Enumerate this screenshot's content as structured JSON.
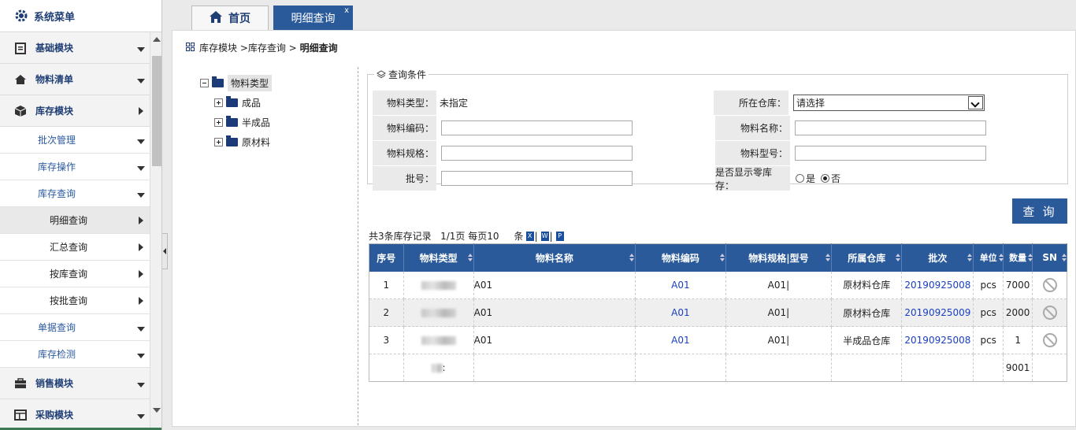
{
  "sidebar": {
    "title": "系统菜单",
    "items": [
      {
        "label": "基础模块"
      },
      {
        "label": "物料清单"
      },
      {
        "label": "库存模块"
      }
    ],
    "subitems": [
      {
        "label": "批次管理"
      },
      {
        "label": "库存操作"
      },
      {
        "label": "库存查询"
      }
    ],
    "subsubitems": [
      {
        "label": "明细查询"
      },
      {
        "label": "汇总查询"
      },
      {
        "label": "按库查询"
      },
      {
        "label": "按批查询"
      }
    ],
    "subitems2": [
      {
        "label": "单据查询"
      },
      {
        "label": "库存检测"
      }
    ],
    "items2": [
      {
        "label": "销售模块"
      },
      {
        "label": "采购模块"
      }
    ]
  },
  "tabs": {
    "home": "首页",
    "active": "明细查询",
    "close": "x"
  },
  "breadcrumb": {
    "path": "库存模块 >库存查询 > ",
    "current": "明细查询"
  },
  "tree": {
    "root": "物料类型",
    "children": [
      "成品",
      "半成品",
      "原材料"
    ]
  },
  "query": {
    "legend": "查询条件",
    "material_type_label": "物料类型：",
    "material_type_value": "未指定",
    "warehouse_label": "所在仓库：",
    "warehouse_value": "请选择",
    "code_label": "物料编码：",
    "name_label": "物料名称：",
    "spec_label": "物料规格：",
    "model_label": "物料型号：",
    "batch_label": "批号：",
    "zero_label": "是否显示零库存：",
    "zero_yes": "是",
    "zero_no": "否",
    "button": "查 询"
  },
  "summary": {
    "text": "共3条库存记录   1/1页 每页10     条"
  },
  "table": {
    "headers": [
      "序号",
      "物料类型",
      "物料名称",
      "物料编码",
      "物料规格|型号",
      "所属仓库",
      "批次",
      "单位",
      "数量",
      "SN"
    ],
    "rows": [
      {
        "no": "1",
        "name": "A01",
        "code": "A01",
        "spec": "A01|",
        "warehouse": "原材料仓库",
        "batch": "20190925008",
        "unit": "pcs",
        "qty": "7000"
      },
      {
        "no": "2",
        "name": "A01",
        "code": "A01",
        "spec": "A01|",
        "warehouse": "原材料仓库",
        "batch": "20190925009",
        "unit": "pcs",
        "qty": "2000"
      },
      {
        "no": "3",
        "name": "A01",
        "code": "A01",
        "spec": "A01|",
        "warehouse": "半成品仓库",
        "batch": "20190925008",
        "unit": "pcs",
        "qty": "1"
      }
    ],
    "total_label": ":",
    "total_qty": "9001"
  }
}
